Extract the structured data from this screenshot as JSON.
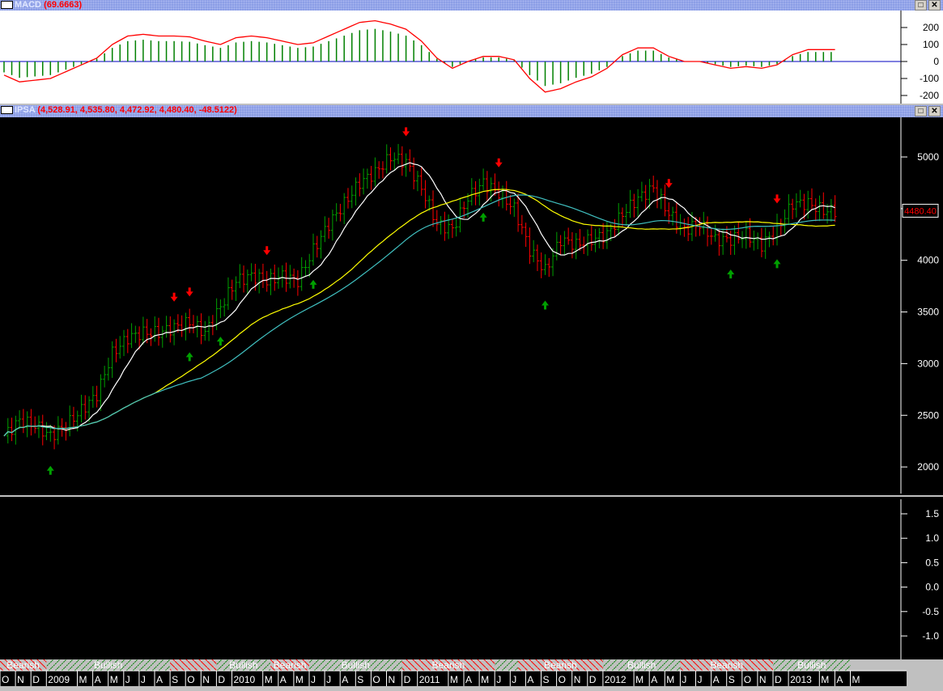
{
  "macd_panel": {
    "name": "MACD",
    "value": "(69.6663)",
    "y_ticks": [
      "200",
      "100",
      "0",
      "-100",
      "-200"
    ],
    "y_tick_values": [
      200,
      100,
      0,
      -100,
      -200
    ]
  },
  "price_panel": {
    "name": "IPSA",
    "value": "(4,528.91, 4,535.80, 4,472.92, 4,480.40, -48.5122)",
    "last_price": "4480.40",
    "y_ticks": [
      "5000",
      "4500",
      "4000",
      "3500",
      "3000",
      "2500",
      "2000"
    ],
    "y_tick_values": [
      5000,
      4500,
      4000,
      3500,
      3000,
      2500,
      2000
    ]
  },
  "lower_panel": {
    "y_ticks": [
      "1.5",
      "1.0",
      "0.5",
      "0.0",
      "-0.5",
      "-1.0"
    ],
    "y_tick_values": [
      1.5,
      1.0,
      0.5,
      0,
      -0.5,
      -1.0
    ]
  },
  "window_buttons": {
    "maximize": "□",
    "close": "✕"
  },
  "colors": {
    "bull_bar": "#00a000",
    "bear_bar": "#ff0000",
    "ma_short": "#ffffff",
    "ma_mid": "#ffff00",
    "ma_long": "#40c0c0",
    "macd_line": "#ff0000",
    "macd_hist": "#008000",
    "zero_line": "#0000c0"
  },
  "chart_data": {
    "type": "bar",
    "months": [
      "O",
      "N",
      "D",
      "2009",
      "M",
      "A",
      "M",
      "J",
      "J",
      "A",
      "S",
      "O",
      "N",
      "D",
      "2010",
      "M",
      "A",
      "M",
      "J",
      "J",
      "A",
      "S",
      "O",
      "N",
      "D",
      "2011",
      "M",
      "A",
      "M",
      "J",
      "J",
      "A",
      "S",
      "O",
      "N",
      "D",
      "2012",
      "M",
      "A",
      "M",
      "J",
      "J",
      "A",
      "S",
      "O",
      "N",
      "D",
      "2013",
      "M",
      "A",
      "M"
    ],
    "month_index": [
      0,
      1,
      2,
      3,
      5,
      6,
      7,
      8,
      9,
      10,
      11,
      12,
      13,
      14,
      15,
      17,
      18,
      19,
      20,
      21,
      22,
      23,
      24,
      25,
      26,
      27,
      29,
      30,
      31,
      32,
      33,
      34,
      35,
      36,
      37,
      38,
      39,
      41,
      42,
      43,
      44,
      45,
      46,
      47,
      48,
      49,
      50,
      51,
      53,
      54,
      55
    ],
    "monthly_close": [
      2300,
      2450,
      2400,
      2300,
      2400,
      2550,
      2700,
      3100,
      3250,
      3300,
      3300,
      3350,
      3400,
      3300,
      3550,
      3800,
      3850,
      3800,
      3850,
      3800,
      4100,
      4350,
      4550,
      4750,
      4850,
      5000,
      4950,
      4700,
      4350,
      4300,
      4600,
      4750,
      4650,
      4500,
      4100,
      3900,
      4200,
      4150,
      4200,
      4250,
      4450,
      4600,
      4700,
      4450,
      4300,
      4350,
      4200,
      4200,
      4250,
      4150,
      4300,
      4550,
      4550,
      4480
    ],
    "macd": [
      -80,
      -120,
      -110,
      -100,
      -60,
      -20,
      20,
      100,
      150,
      160,
      150,
      150,
      145,
      120,
      100,
      140,
      150,
      140,
      120,
      100,
      110,
      150,
      190,
      230,
      240,
      220,
      190,
      120,
      20,
      -40,
      0,
      30,
      30,
      10,
      -100,
      -180,
      -160,
      -120,
      -90,
      -40,
      40,
      80,
      80,
      30,
      0,
      0,
      -20,
      -40,
      -30,
      -40,
      -20,
      40,
      70,
      70
    ],
    "sell_signals": [
      11,
      12,
      17,
      26,
      32,
      43,
      50
    ],
    "buy_signals": [
      3,
      12,
      14,
      20,
      31,
      35,
      47,
      50
    ],
    "sentiment_bands": [
      {
        "label": "Bearish",
        "start": 0,
        "end": 3
      },
      {
        "label": "Bullish",
        "start": 3,
        "end": 11
      },
      {
        "label": "",
        "start": 11,
        "end": 14
      },
      {
        "label": "Bullish",
        "start": 14,
        "end": 17.5
      },
      {
        "label": "Bearish",
        "start": 17.5,
        "end": 20
      },
      {
        "label": "Bullish",
        "start": 20,
        "end": 26
      },
      {
        "label": "Bearish",
        "start": 26,
        "end": 32
      },
      {
        "label": "",
        "start": 32,
        "end": 33.5
      },
      {
        "label": "Bearish",
        "start": 33.5,
        "end": 39
      },
      {
        "label": "Bullish",
        "start": 39,
        "end": 44
      },
      {
        "label": "Bearish",
        "start": 44,
        "end": 50
      },
      {
        "label": "Bullish",
        "start": 50,
        "end": 55
      }
    ],
    "ylim_price": [
      1800,
      5300
    ],
    "ylim_macd": [
      -230,
      250
    ],
    "ylim_lower": [
      -1.3,
      1.7
    ]
  }
}
